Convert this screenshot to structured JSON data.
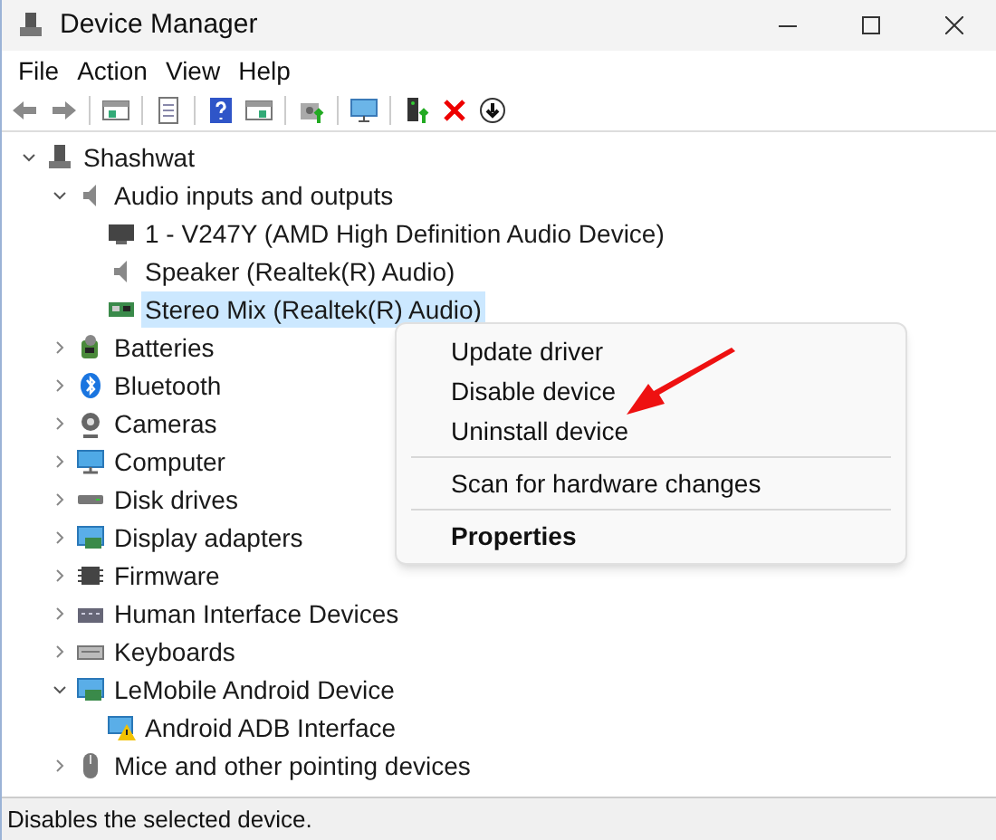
{
  "window": {
    "title": "Device Manager"
  },
  "menu": [
    "File",
    "Action",
    "View",
    "Help"
  ],
  "toolbar": [
    {
      "kind": "back",
      "disabled": false
    },
    {
      "kind": "forward",
      "disabled": false
    },
    {
      "kind": "sep"
    },
    {
      "kind": "pane"
    },
    {
      "kind": "sep"
    },
    {
      "kind": "sheet"
    },
    {
      "kind": "sep"
    },
    {
      "kind": "help"
    },
    {
      "kind": "pane2"
    },
    {
      "kind": "sep"
    },
    {
      "kind": "update"
    },
    {
      "kind": "sep"
    },
    {
      "kind": "scan"
    },
    {
      "kind": "sep"
    },
    {
      "kind": "enable"
    },
    {
      "kind": "remove"
    },
    {
      "kind": "download"
    }
  ],
  "tree": [
    {
      "label": "Shashwat",
      "kind": "computer",
      "expanded": true,
      "selected": false,
      "children": [
        {
          "label": "Audio inputs and outputs",
          "kind": "speaker",
          "expanded": true,
          "selected": false,
          "children": [
            {
              "label": "1 - V247Y (AMD High Definition Audio Device)",
              "kind": "monitor",
              "selected": false
            },
            {
              "label": "Speaker (Realtek(R) Audio)",
              "kind": "speaker",
              "selected": false
            },
            {
              "label": "Stereo Mix (Realtek(R) Audio)",
              "kind": "card",
              "selected": true
            }
          ]
        },
        {
          "label": "Batteries",
          "kind": "battery",
          "expanded": false,
          "selected": false
        },
        {
          "label": "Bluetooth",
          "kind": "bluetooth",
          "expanded": false,
          "selected": false
        },
        {
          "label": "Cameras",
          "kind": "camera",
          "expanded": false,
          "selected": false
        },
        {
          "label": "Computer",
          "kind": "screen",
          "expanded": false,
          "selected": false
        },
        {
          "label": "Disk drives",
          "kind": "disk",
          "expanded": false,
          "selected": false
        },
        {
          "label": "Display adapters",
          "kind": "adapter",
          "expanded": false,
          "selected": false
        },
        {
          "label": "Firmware",
          "kind": "chip",
          "expanded": false,
          "selected": false
        },
        {
          "label": "Human Interface Devices",
          "kind": "hid",
          "expanded": false,
          "selected": false
        },
        {
          "label": "Keyboards",
          "kind": "keyboard",
          "expanded": false,
          "selected": false
        },
        {
          "label": "LeMobile Android Device",
          "kind": "adapter",
          "expanded": true,
          "selected": false,
          "children": [
            {
              "label": "Android ADB Interface",
              "kind": "warning",
              "selected": false
            }
          ]
        },
        {
          "label": "Mice and other pointing devices",
          "kind": "mouse",
          "expanded": false,
          "selected": false
        }
      ]
    }
  ],
  "context_menu": [
    {
      "kind": "item",
      "label": "Update driver",
      "bold": false
    },
    {
      "kind": "item",
      "label": "Disable device",
      "bold": false
    },
    {
      "kind": "item",
      "label": "Uninstall device",
      "bold": false
    },
    {
      "kind": "separator"
    },
    {
      "kind": "item",
      "label": "Scan for hardware changes",
      "bold": false
    },
    {
      "kind": "separator"
    },
    {
      "kind": "item",
      "label": "Properties",
      "bold": true
    }
  ],
  "status_bar": "Disables the selected device."
}
